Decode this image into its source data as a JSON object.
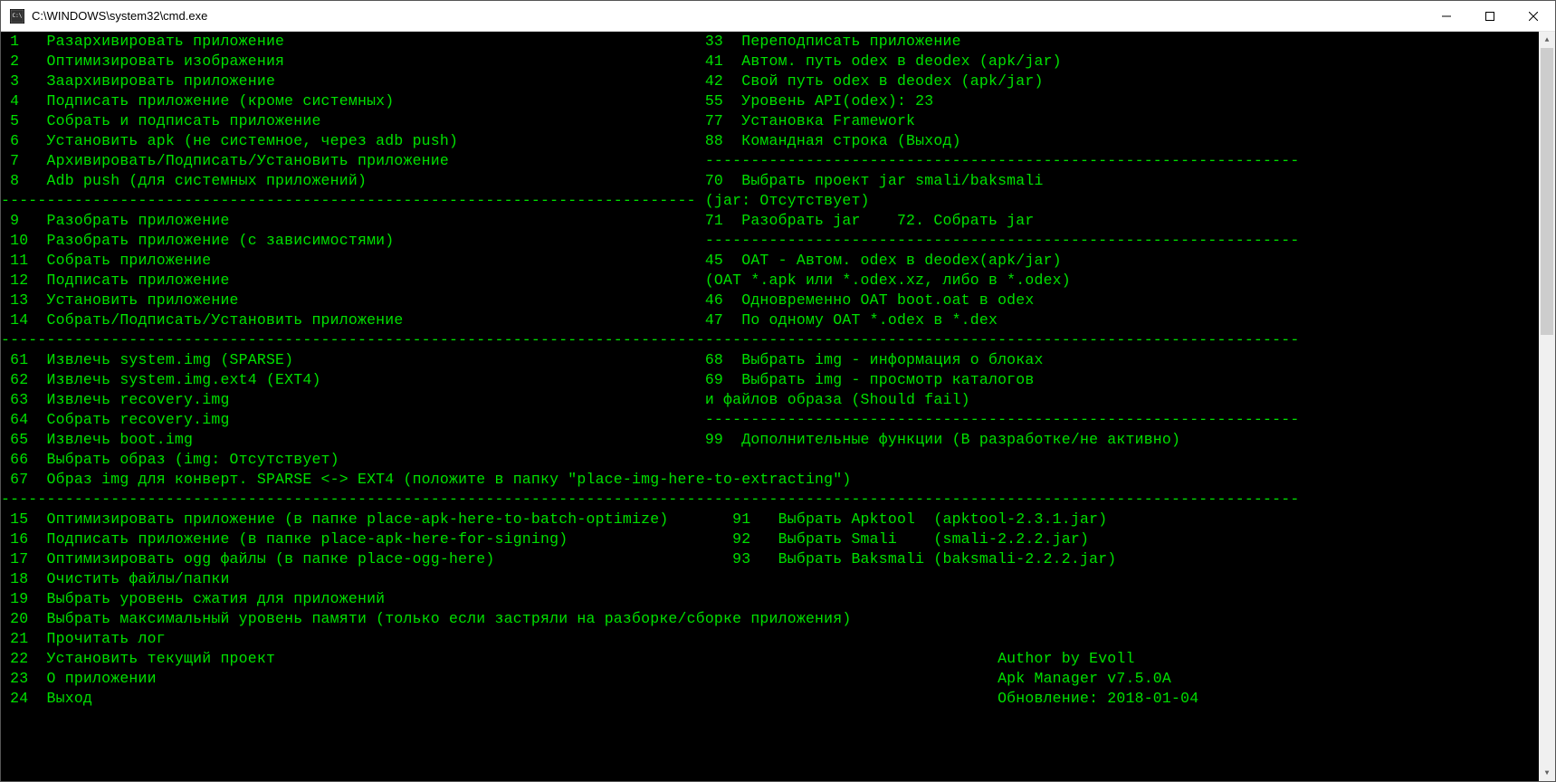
{
  "window": {
    "title": "C:\\WINDOWS\\system32\\cmd.exe"
  },
  "terminal": {
    "left": [
      " 1   Разархивировать приложение",
      " 2   Оптимизировать изображения",
      " 3   Заархивировать приложение",
      " 4   Подписать приложение (кроме системных)",
      " 5   Собрать и подписать приложение",
      " 6   Установить apk (не системное, через adb push)",
      " 7   Архивировать/Подписать/Установить приложение",
      " 8   Adb push (для системных приложений)",
      "----------------------------------------------------------------------------",
      " 9   Разобрать приложение",
      " 10  Разобрать приложение (с зависимостями)",
      " 11  Собрать приложение",
      " 12  Подписать приложение",
      " 13  Установить приложение",
      " 14  Собрать/Подписать/Установить приложение"
    ],
    "right": [
      " 33  Переподписать приложение",
      " 41  Автом. путь odex в deodex (apk/jar)",
      " 42  Свой путь odex в deodex (apk/jar)",
      " 55  Уровень API(odex): 23",
      " 77  Установка Framework",
      " 88  Командная строка (Выход)",
      " -----------------------------------------------------------------",
      " 70  Выбрать проект jar smali/baksmali",
      " (jar: Отсутствует)",
      " 71  Разобрать jar    72. Собрать jar",
      " -----------------------------------------------------------------",
      " 45  OAT - Автом. odex в deodex(apk/jar)",
      " (OAT *.apk или *.odex.xz, либо в *.odex)",
      " 46  Одновременно OAT boot.oat в odex",
      " 47  По одному OAT *.odex в *.dex"
    ],
    "sep1": "----------------------------------------------------------------------------------------------------------------------------------------------",
    "mid_left": [
      " 61  Извлечь system.img (SPARSE)",
      " 62  Извлечь system.img.ext4 (EXT4)",
      " 63  Извлечь recovery.img",
      " 64  Собрать recovery.img",
      " 65  Извлечь boot.img",
      " 66  Выбрать образ (img: Отсутствует)"
    ],
    "mid_right": [
      " 68  Выбрать img - информация о блоках",
      " 69  Выбрать img - просмотр каталогов",
      " и файлов образа (Should fail)",
      " -----------------------------------------------------------------",
      " 99  Дополнительные функции (В разработке/не активно)",
      ""
    ],
    "mid_full": " 67  Образ img для конверт. SPARSE <-> EXT4 (положите в папку \"place-img-here-to-extracting\")",
    "sep2": "----------------------------------------------------------------------------------------------------------------------------------------------",
    "bot_left": [
      " 15  Оптимизировать приложение (в папке place-apk-here-to-batch-optimize)",
      " 16  Подписать приложение (в папке place-apk-here-for-signing)",
      " 17  Оптимизировать ogg файлы (в папке place-ogg-here)",
      " 18  Очистить файлы/папки",
      " 19  Выбрать уровень сжатия для приложений",
      " 20  Выбрать максимальный уровень памяти (только если застряли на разборке/сборке приложения)",
      " 21  Прочитать лог",
      " 22  Установить текущий проект",
      " 23  О приложении",
      " 24  Выход"
    ],
    "bot_right": [
      "    91   Выбрать Apktool  (apktool-2.3.1.jar)",
      "    92   Выбрать Smali    (smali-2.2.2.jar)",
      "    93   Выбрать Baksmali (baksmali-2.2.2.jar)",
      "",
      "",
      "",
      "",
      "                                 Author by Evoll",
      "                                 Apk Manager v7.5.0A",
      "                                 Обновление: 2018-01-04"
    ]
  }
}
